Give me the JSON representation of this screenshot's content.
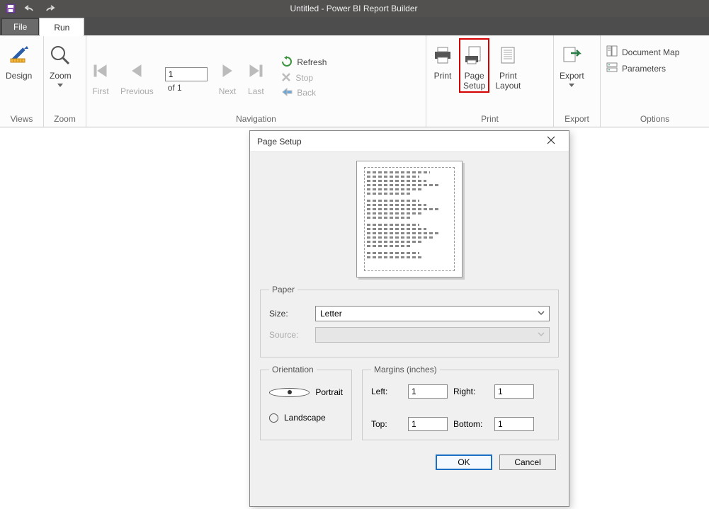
{
  "title": "Untitled - Power BI Report Builder",
  "tabs": {
    "file": "File",
    "run": "Run"
  },
  "ribbon": {
    "views": {
      "design": "Design",
      "label": "Views"
    },
    "zoom": {
      "zoom": "Zoom",
      "label": "Zoom"
    },
    "nav": {
      "first": "First",
      "previous": "Previous",
      "next": "Next",
      "last": "Last",
      "page_value": "1",
      "of_text": "of  1",
      "refresh": "Refresh",
      "stop": "Stop",
      "back": "Back",
      "label": "Navigation"
    },
    "print": {
      "print": "Print",
      "page_setup": "Page\nSetup",
      "print_layout": "Print\nLayout",
      "label": "Print"
    },
    "export": {
      "export": "Export",
      "label": "Export"
    },
    "options": {
      "document_map": "Document Map",
      "parameters": "Parameters",
      "label": "Options"
    }
  },
  "dialog": {
    "title": "Page Setup",
    "paper": {
      "legend": "Paper",
      "size_label": "Size:",
      "size_value": "Letter",
      "source_label": "Source:"
    },
    "orientation": {
      "legend": "Orientation",
      "portrait": "Portrait",
      "landscape": "Landscape",
      "selected": "portrait"
    },
    "margins": {
      "legend": "Margins (inches)",
      "left_label": "Left:",
      "left": "1",
      "right_label": "Right:",
      "right": "1",
      "top_label": "Top:",
      "top": "1",
      "bottom_label": "Bottom:",
      "bottom": "1"
    },
    "ok": "OK",
    "cancel": "Cancel"
  }
}
